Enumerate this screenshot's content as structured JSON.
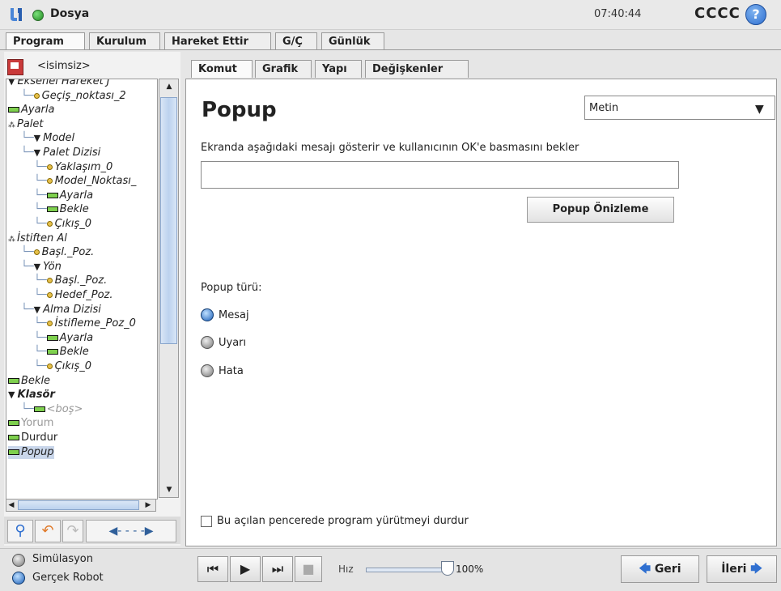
{
  "titlebar": {
    "file_menu": "Dosya",
    "clock": "07:40:44",
    "robot_name": "CCCC",
    "help": "?"
  },
  "main_tabs": [
    {
      "label": "Program",
      "active": true
    },
    {
      "label": "Kurulum"
    },
    {
      "label": "Hareket Ettir"
    },
    {
      "label": "G/Ç"
    },
    {
      "label": "Günlük"
    }
  ],
  "program": {
    "name": "<isimsiz>"
  },
  "tree": [
    {
      "label": "Eksenel Hareket J",
      "sym": "tri",
      "indent": 0
    },
    {
      "label": "Geçiş_noktası_2",
      "sym": "dot",
      "indent": 1
    },
    {
      "label": "Ayarla",
      "sym": "bar",
      "indent": 0
    },
    {
      "label": "Palet",
      "sym": "dots",
      "indent": 0
    },
    {
      "label": "Model",
      "sym": "tri",
      "indent": 1
    },
    {
      "label": "Palet Dizisi",
      "sym": "tri",
      "indent": 1
    },
    {
      "label": "Yaklaşım_0",
      "sym": "dot",
      "indent": 2
    },
    {
      "label": "Model_Noktası_",
      "sym": "dot",
      "indent": 2
    },
    {
      "label": "Ayarla",
      "sym": "bar",
      "indent": 2
    },
    {
      "label": "Bekle",
      "sym": "bar",
      "indent": 2
    },
    {
      "label": "Çıkış_0",
      "sym": "dot",
      "indent": 2
    },
    {
      "label": "İstiften Al",
      "sym": "dots",
      "indent": 0
    },
    {
      "label": "Başl._Poz.",
      "sym": "dot",
      "indent": 1
    },
    {
      "label": "Yön",
      "sym": "tri",
      "indent": 1
    },
    {
      "label": "Başl._Poz.",
      "sym": "dot",
      "indent": 2
    },
    {
      "label": "Hedef_Poz.",
      "sym": "dot",
      "indent": 2
    },
    {
      "label": "Alma Dizisi",
      "sym": "tri",
      "indent": 1
    },
    {
      "label": "İstifleme_Poz_0",
      "sym": "dot",
      "indent": 2
    },
    {
      "label": "Ayarla",
      "sym": "bar",
      "indent": 2
    },
    {
      "label": "Bekle",
      "sym": "bar",
      "indent": 2
    },
    {
      "label": "Çıkış_0",
      "sym": "dot",
      "indent": 2
    },
    {
      "label": "Bekle",
      "sym": "bar",
      "indent": 0
    },
    {
      "label": "Klasör",
      "sym": "tri",
      "indent": 0,
      "bold": true
    },
    {
      "label": "<boş>",
      "sym": "bar",
      "indent": 1,
      "gray": true
    },
    {
      "label": "Yorum",
      "sym": "bar",
      "indent": 0,
      "gray": true,
      "plain": true
    },
    {
      "label": "Durdur",
      "sym": "bar",
      "indent": 0,
      "plain": true
    },
    {
      "label": "Popup",
      "sym": "bar",
      "indent": 0,
      "selected": true
    }
  ],
  "sub_tabs": [
    {
      "label": "Komut",
      "active": true
    },
    {
      "label": "Grafik"
    },
    {
      "label": "Yapı"
    },
    {
      "label": "Değişkenler"
    }
  ],
  "popup": {
    "title": "Popup",
    "type_select": "Metin",
    "description": "Ekranda aşağıdaki mesajı gösterir ve kullanıcının OK'e basmasını bekler",
    "message_value": "",
    "preview_button": "Popup Önizleme",
    "type_label": "Popup türü:",
    "types": [
      {
        "label": "Mesaj",
        "selected": true
      },
      {
        "label": "Uyarı"
      },
      {
        "label": "Hata"
      }
    ],
    "halt_checkbox": "Bu açılan pencerede program yürütmeyi durdur",
    "halt_checked": false
  },
  "mode": {
    "simulation": "Simülasyon",
    "real_robot": "Gerçek Robot",
    "selected": "Gerçek Robot"
  },
  "speed": {
    "label": "Hız",
    "value": "100%",
    "fraction": 1.0
  },
  "nav": {
    "back": "Geri",
    "next": "İleri"
  }
}
